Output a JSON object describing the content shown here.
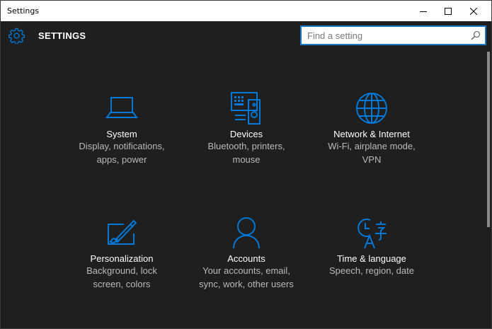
{
  "window": {
    "title": "Settings"
  },
  "header": {
    "title": "SETTINGS",
    "icon": "gear-icon"
  },
  "search": {
    "placeholder": "Find a setting",
    "icon": "search-icon"
  },
  "colors": {
    "accent": "#0078d7",
    "background": "#1f1f1f",
    "text": "#ffffff",
    "subtext": "#b9b9b9"
  },
  "tiles": [
    {
      "name": "System",
      "line1": "Display, notifications,",
      "line2": "apps, power",
      "icon": "laptop-icon"
    },
    {
      "name": "Devices",
      "line1": "Bluetooth, printers,",
      "line2": "mouse",
      "icon": "devices-icon"
    },
    {
      "name": "Network & Internet",
      "line1": "Wi-Fi, airplane mode,",
      "line2": "VPN",
      "icon": "globe-icon"
    },
    {
      "name": "Personalization",
      "line1": "Background, lock",
      "line2": "screen, colors",
      "icon": "paintbrush-icon"
    },
    {
      "name": "Accounts",
      "line1": "Your accounts, email,",
      "line2": "sync, work, other users",
      "icon": "person-icon"
    },
    {
      "name": "Time & language",
      "line1": "Speech, region, date",
      "line2": "",
      "icon": "time-language-icon"
    }
  ]
}
